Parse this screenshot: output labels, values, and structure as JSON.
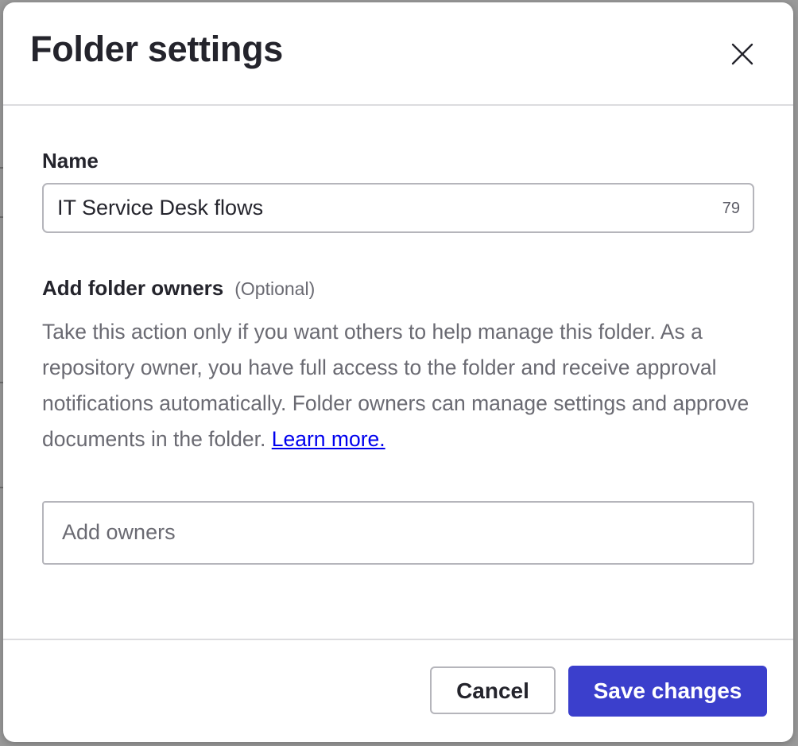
{
  "dialog": {
    "title": "Folder settings",
    "close_icon": "close-icon"
  },
  "name_field": {
    "label": "Name",
    "value": "IT Service Desk flows",
    "char_counter": "79"
  },
  "owners_field": {
    "label": "Add folder owners",
    "optional_tag": "(Optional)",
    "description": "Take this action only if you want others to help manage this folder. As a repository owner, you have full access to the folder and receive approval notifications automatically. Folder owners can manage settings and approve documents in the folder.",
    "learn_more_link": "Learn more.",
    "placeholder": "Add owners"
  },
  "footer": {
    "cancel_label": "Cancel",
    "save_label": "Save changes"
  },
  "colors": {
    "primary_button": "#3b3fcc",
    "title_text": "#24242c",
    "muted_text": "#6a6a72",
    "link": "#0000ee"
  }
}
